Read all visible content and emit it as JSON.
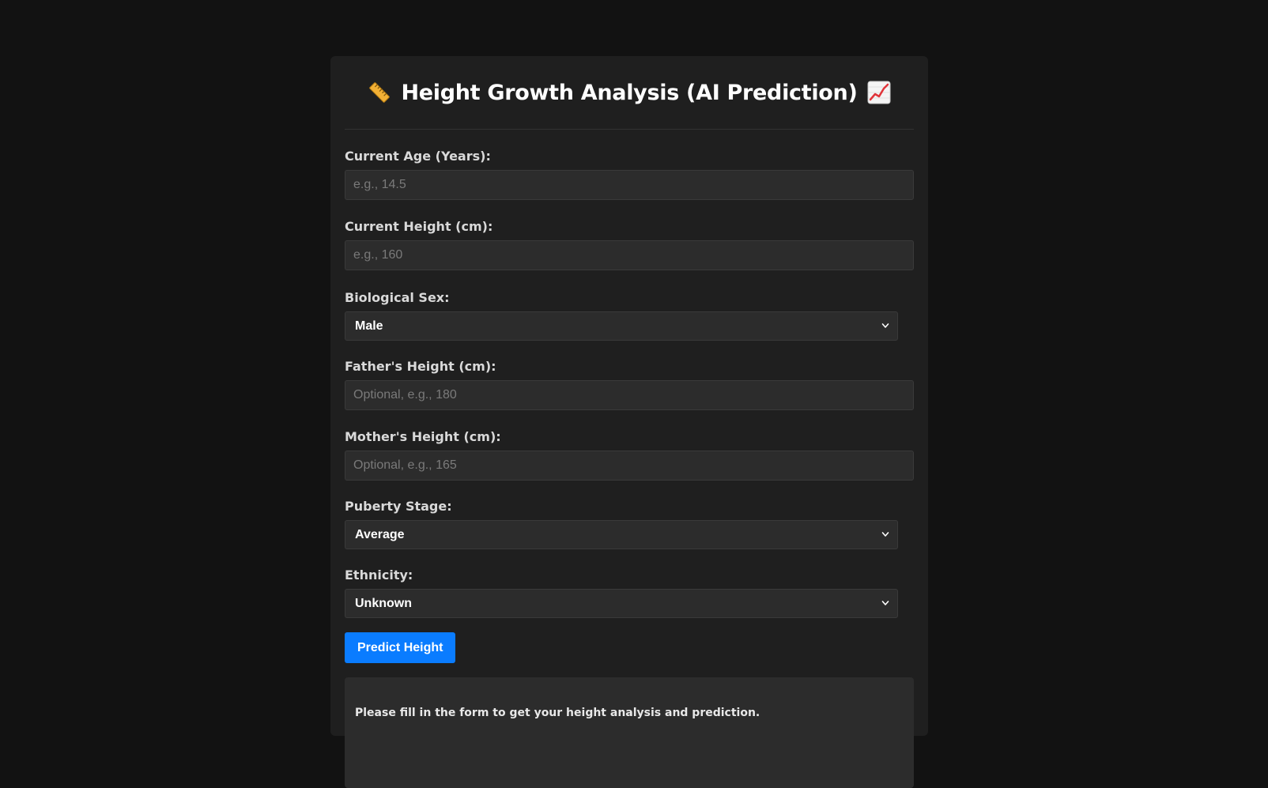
{
  "header": {
    "title": "Height Growth Analysis (AI Prediction)",
    "left_icon": "ruler-icon",
    "right_icon": "chart-increasing-icon"
  },
  "form": {
    "age": {
      "label": "Current Age (Years):",
      "value": "",
      "placeholder": "e.g., 14.5"
    },
    "height": {
      "label": "Current Height (cm):",
      "value": "",
      "placeholder": "e.g., 160"
    },
    "sex": {
      "label": "Biological Sex:",
      "selected": "Male"
    },
    "father_height": {
      "label": "Father's Height (cm):",
      "value": "",
      "placeholder": "Optional, e.g., 180"
    },
    "mother_height": {
      "label": "Mother's Height (cm):",
      "value": "",
      "placeholder": "Optional, e.g., 165"
    },
    "puberty": {
      "label": "Puberty Stage:",
      "selected": "Average"
    },
    "ethnicity": {
      "label": "Ethnicity:",
      "selected": "Unknown"
    },
    "submit_label": "Predict Height"
  },
  "result": {
    "message": "Please fill in the form to get your height analysis and prediction."
  },
  "colors": {
    "background": "#121212",
    "card": "#1f1f1f",
    "field": "#2c2c2c",
    "accent": "#0a7cff"
  }
}
